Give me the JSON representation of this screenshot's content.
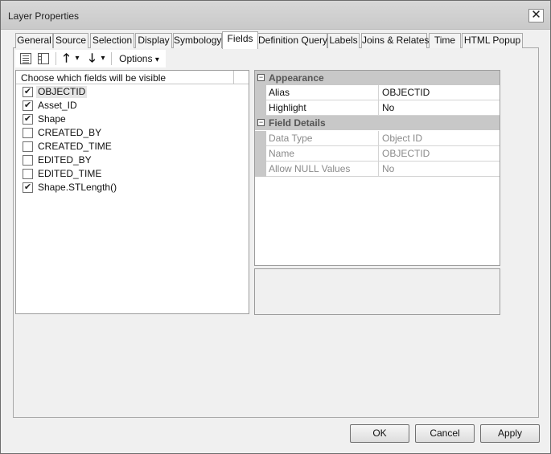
{
  "window": {
    "title": "Layer Properties",
    "close_glyph": "✕"
  },
  "tabs": [
    {
      "label": "General"
    },
    {
      "label": "Source"
    },
    {
      "label": "Selection"
    },
    {
      "label": "Display"
    },
    {
      "label": "Symbology"
    },
    {
      "label": "Fields",
      "active": true
    },
    {
      "label": "Definition Query"
    },
    {
      "label": "Labels"
    },
    {
      "label": "Joins & Relates"
    },
    {
      "label": "Time"
    },
    {
      "label": "HTML Popup"
    }
  ],
  "toolbar": {
    "list_view_icon": "list-view-icon",
    "table_view_icon": "table-view-icon",
    "move_up_glyph": "🡑",
    "move_down_glyph": "🡓",
    "dropdown_glyph": "▾",
    "options_label": "Options"
  },
  "field_list": {
    "header": "Choose which fields will be visible",
    "check_glyph": "✔",
    "fields": [
      {
        "name": "OBJECTID",
        "checked": true,
        "selected": true
      },
      {
        "name": "Asset_ID",
        "checked": true
      },
      {
        "name": "Shape",
        "checked": true
      },
      {
        "name": "CREATED_BY",
        "checked": false
      },
      {
        "name": "CREATED_TIME",
        "checked": false
      },
      {
        "name": "EDITED_BY",
        "checked": false
      },
      {
        "name": "EDITED_TIME",
        "checked": false
      },
      {
        "name": "Shape.STLength()",
        "checked": true
      }
    ]
  },
  "properties": {
    "collapse_glyph": "−",
    "appearance": {
      "label": "Appearance",
      "rows": [
        {
          "name": "Alias",
          "value": "OBJECTID"
        },
        {
          "name": "Highlight",
          "value": "No"
        }
      ]
    },
    "field_details": {
      "label": "Field Details",
      "rows": [
        {
          "name": "Data Type",
          "value": "Object ID"
        },
        {
          "name": "Name",
          "value": "OBJECTID"
        },
        {
          "name": "Allow NULL Values",
          "value": "No"
        }
      ]
    }
  },
  "buttons": {
    "ok": "OK",
    "cancel": "Cancel",
    "apply": "Apply"
  }
}
